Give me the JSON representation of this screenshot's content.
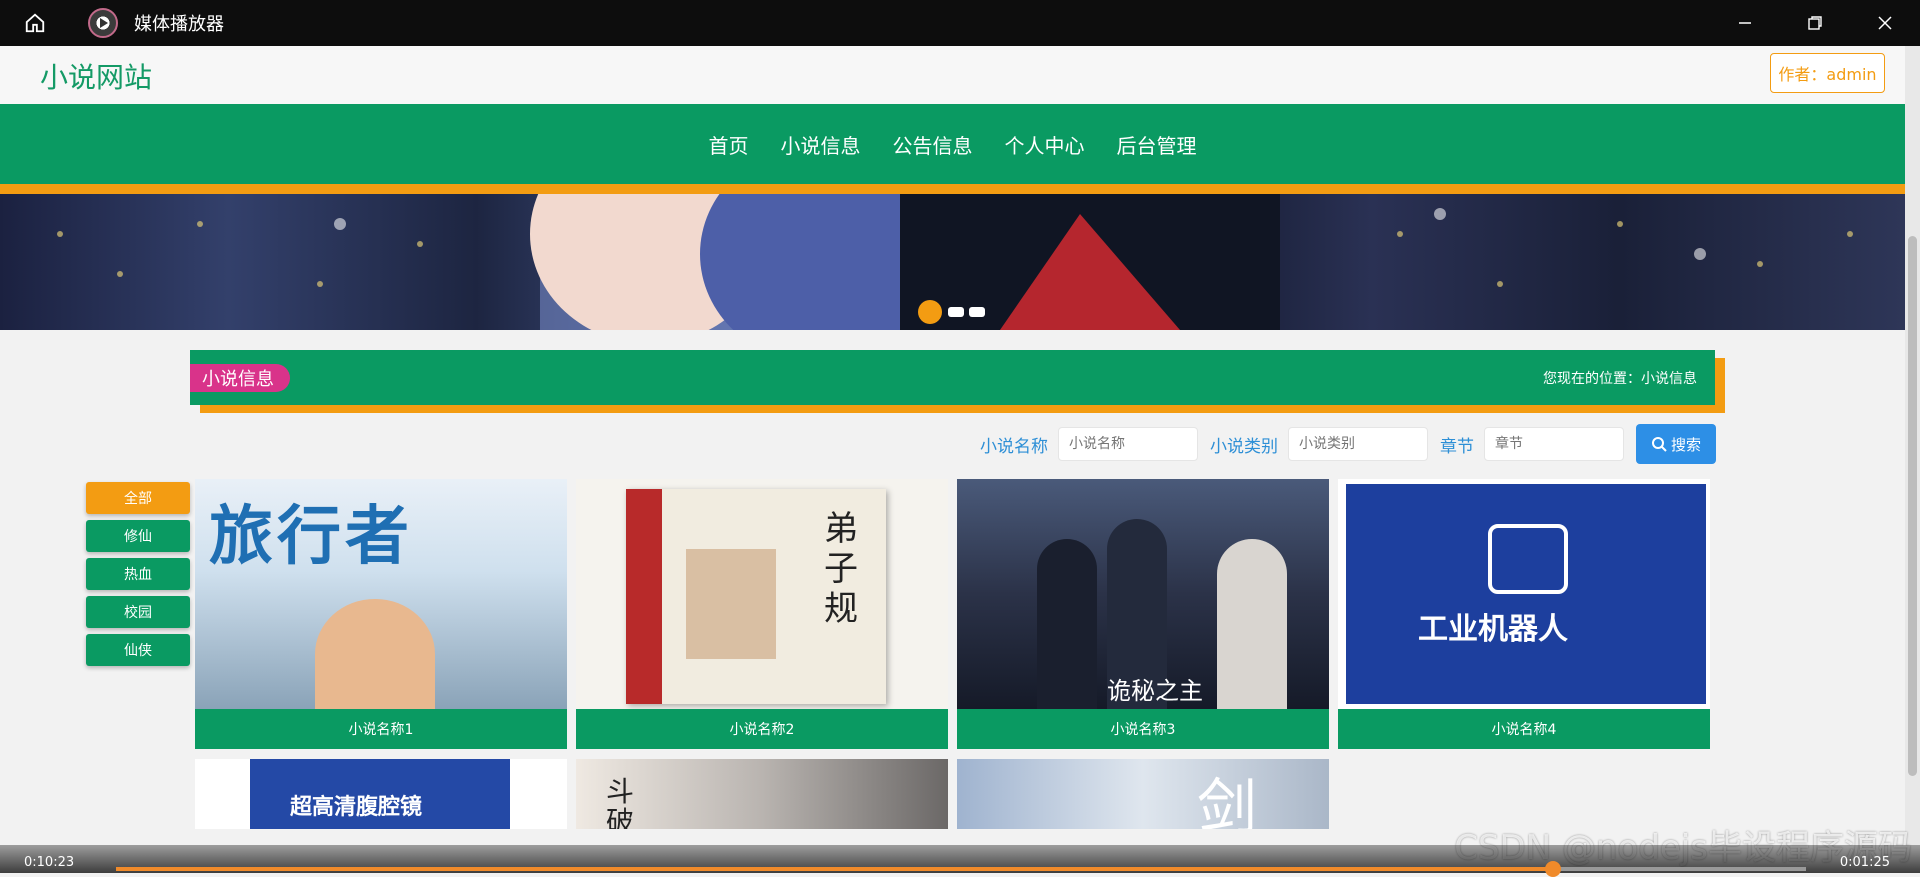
{
  "player": {
    "title": "媒体播放器",
    "time_elapsed": "0:10:23",
    "time_total": "0:01:25",
    "progress": 0.85,
    "watermark": "CSDN @nodejs毕设程序源码"
  },
  "site": {
    "logo": "小说网站",
    "author": "作者：admin"
  },
  "nav": {
    "items": [
      "首页",
      "小说信息",
      "公告信息",
      "个人中心",
      "后台管理"
    ]
  },
  "section": {
    "title": "小说信息",
    "breadcrumb": "您现在的位置：小说信息"
  },
  "search": {
    "name_label": "小说名称",
    "name_placeholder": "小说名称",
    "category_label": "小说类别",
    "category_placeholder": "小说类别",
    "chapter_label": "章节",
    "chapter_placeholder": "章节",
    "button": "搜索"
  },
  "categories": [
    "全部",
    "修仙",
    "热血",
    "校园",
    "仙侠"
  ],
  "novels": [
    {
      "title": "小说名称1",
      "cover_text": "旅行者"
    },
    {
      "title": "小说名称2",
      "cover_text": "弟子规"
    },
    {
      "title": "小说名称3",
      "cover_text": "诡秘之主"
    },
    {
      "title": "小说名称4",
      "cover_text": "工业机器人"
    },
    {
      "title": "",
      "cover_text": "超高清腹腔镜"
    },
    {
      "title": "",
      "cover_text": "斗破"
    },
    {
      "title": "",
      "cover_text": "剑"
    }
  ],
  "colors": {
    "primary": "#0a9a62",
    "accent": "#f39c12",
    "tag": "#d9338a",
    "link": "#2d8fd6"
  }
}
